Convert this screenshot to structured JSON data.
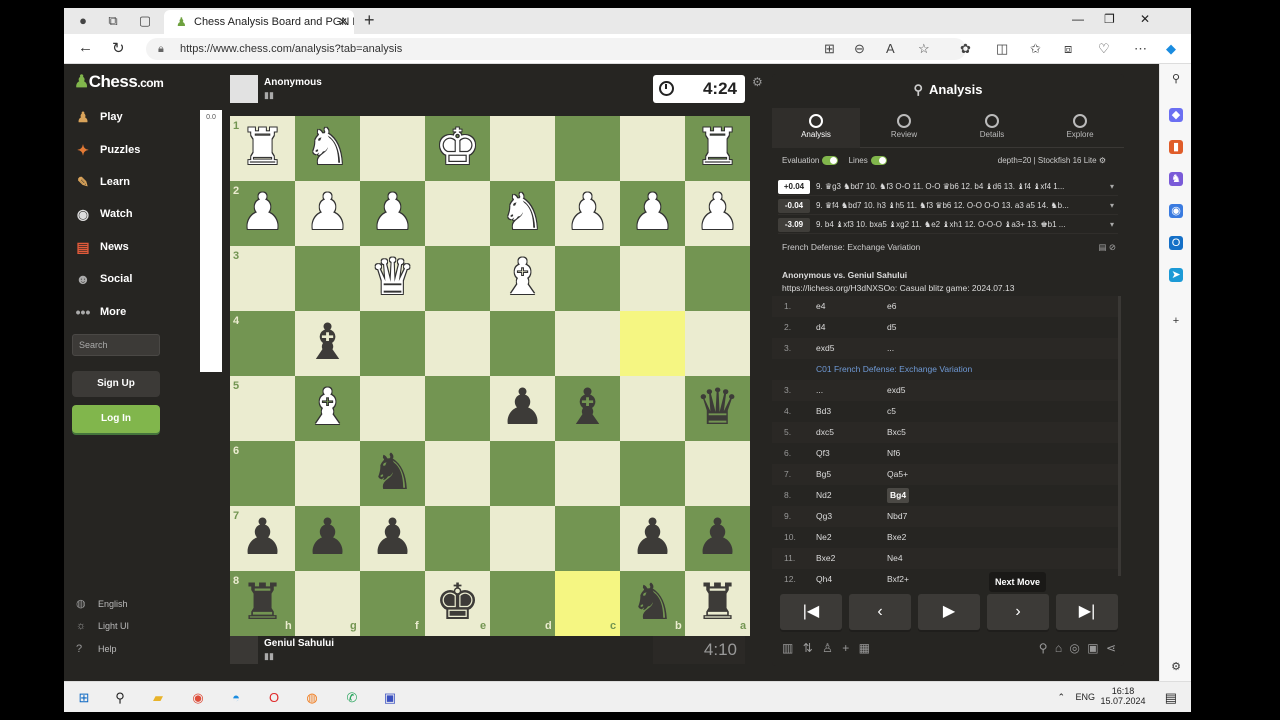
{
  "browser": {
    "tab_title": "Chess Analysis Board and PGN Edi",
    "url": "https://www.chess.com/analysis?tab=analysis"
  },
  "site": {
    "logo": "Chess",
    "logo_suffix": ".com",
    "nav": [
      "Play",
      "Puzzles",
      "Learn",
      "Watch",
      "News",
      "Social",
      "More"
    ],
    "search_placeholder": "Search",
    "signup": "Sign Up",
    "login": "Log In",
    "footer": [
      "English",
      "Light UI",
      "Help"
    ]
  },
  "game": {
    "top_player": "Anonymous",
    "bottom_player": "Geniul Sahului",
    "top_clock": "4:24",
    "bottom_clock": "4:10",
    "eval_label": "0.0",
    "ranks": [
      "1",
      "2",
      "3",
      "4",
      "5",
      "6",
      "7",
      "8"
    ],
    "files": [
      "h",
      "g",
      "f",
      "e",
      "d",
      "c",
      "b",
      "a"
    ],
    "highlight": [
      "b4",
      "c8"
    ],
    "pieces": [
      {
        "sq": "h1",
        "p": "♜",
        "c": "w"
      },
      {
        "sq": "g1",
        "p": "♞",
        "c": "w"
      },
      {
        "sq": "e1",
        "p": "♚",
        "c": "w"
      },
      {
        "sq": "a1",
        "p": "♜",
        "c": "w"
      },
      {
        "sq": "h2",
        "p": "♟",
        "c": "w"
      },
      {
        "sq": "g2",
        "p": "♟",
        "c": "w"
      },
      {
        "sq": "f2",
        "p": "♟",
        "c": "w"
      },
      {
        "sq": "d2",
        "p": "♞",
        "c": "w"
      },
      {
        "sq": "c2",
        "p": "♟",
        "c": "w"
      },
      {
        "sq": "b2",
        "p": "♟",
        "c": "w"
      },
      {
        "sq": "a2",
        "p": "♟",
        "c": "w"
      },
      {
        "sq": "f3",
        "p": "♛",
        "c": "w"
      },
      {
        "sq": "d3",
        "p": "♝",
        "c": "w"
      },
      {
        "sq": "g4",
        "p": "♝",
        "c": "b"
      },
      {
        "sq": "g5",
        "p": "♝",
        "c": "w"
      },
      {
        "sq": "d5",
        "p": "♟",
        "c": "b"
      },
      {
        "sq": "c5",
        "p": "♝",
        "c": "b"
      },
      {
        "sq": "a5",
        "p": "♛",
        "c": "b"
      },
      {
        "sq": "f6",
        "p": "♞",
        "c": "b"
      },
      {
        "sq": "h7",
        "p": "♟",
        "c": "b"
      },
      {
        "sq": "g7",
        "p": "♟",
        "c": "b"
      },
      {
        "sq": "f7",
        "p": "♟",
        "c": "b"
      },
      {
        "sq": "b7",
        "p": "♟",
        "c": "b"
      },
      {
        "sq": "a7",
        "p": "♟",
        "c": "b"
      },
      {
        "sq": "h8",
        "p": "♜",
        "c": "b"
      },
      {
        "sq": "e8",
        "p": "♚",
        "c": "b"
      },
      {
        "sq": "b8",
        "p": "♞",
        "c": "b"
      },
      {
        "sq": "a8",
        "p": "♜",
        "c": "b"
      }
    ]
  },
  "analysis": {
    "title": "Analysis",
    "tabs": [
      "Analysis",
      "Review",
      "Details",
      "Explore"
    ],
    "evaluation_label": "Evaluation",
    "lines_label": "Lines",
    "engine": "depth=20 | Stockfish 16 Lite",
    "lines": [
      {
        "score": "+0.04",
        "text": "9. ♛g3 ♞bd7 10. ♞f3 O-O 11. O-O ♛b6 12. b4 ♝d6 13. ♝f4 ♝xf4 1..."
      },
      {
        "score": "-0.04",
        "text": "9. ♛f4 ♞bd7 10. h3 ♝h5 11. ♞f3 ♛b6 12. O-O O-O 13. a3 a5 14. ♞b..."
      },
      {
        "score": "-3.09",
        "text": "9. b4 ♝xf3 10. bxa5 ♝xg2 11. ♞e2 ♝xh1 12. O-O-O ♝a3+ 13. ♚b1 ..."
      }
    ],
    "opening": "French Defense: Exchange Variation",
    "players": "Anonymous vs. Geniul Sahului",
    "source": "https://lichess.org/H3dNXSOo: Casual blitz game: 2024.07.13",
    "moves": [
      {
        "n": "1.",
        "w": "e4",
        "b": "e6"
      },
      {
        "n": "2.",
        "w": "d4",
        "b": "d5"
      },
      {
        "n": "3.",
        "w": "exd5",
        "b": "..."
      },
      {
        "n": "",
        "w": "C01 French Defense: Exchange Variation",
        "b": ""
      },
      {
        "n": "3.",
        "w": "...",
        "b": "exd5"
      },
      {
        "n": "4.",
        "w": "Bd3",
        "b": "c5"
      },
      {
        "n": "5.",
        "w": "dxc5",
        "b": "Bxc5"
      },
      {
        "n": "6.",
        "w": "Qf3",
        "b": "Nf6"
      },
      {
        "n": "7.",
        "w": "Bg5",
        "b": "Qa5+"
      },
      {
        "n": "8.",
        "w": "Nd2",
        "b": "Bg4"
      },
      {
        "n": "9.",
        "w": "Qg3",
        "b": "Nbd7"
      },
      {
        "n": "10.",
        "w": "Ne2",
        "b": "Bxe2"
      },
      {
        "n": "11.",
        "w": "Bxe2",
        "b": "Ne4"
      },
      {
        "n": "12.",
        "w": "Qh4",
        "b": "Bxf2+"
      }
    ],
    "tooltip": "Next Move"
  },
  "taskbar": {
    "lang": "ENG",
    "time": "16:18",
    "date": "15.07.2024"
  }
}
